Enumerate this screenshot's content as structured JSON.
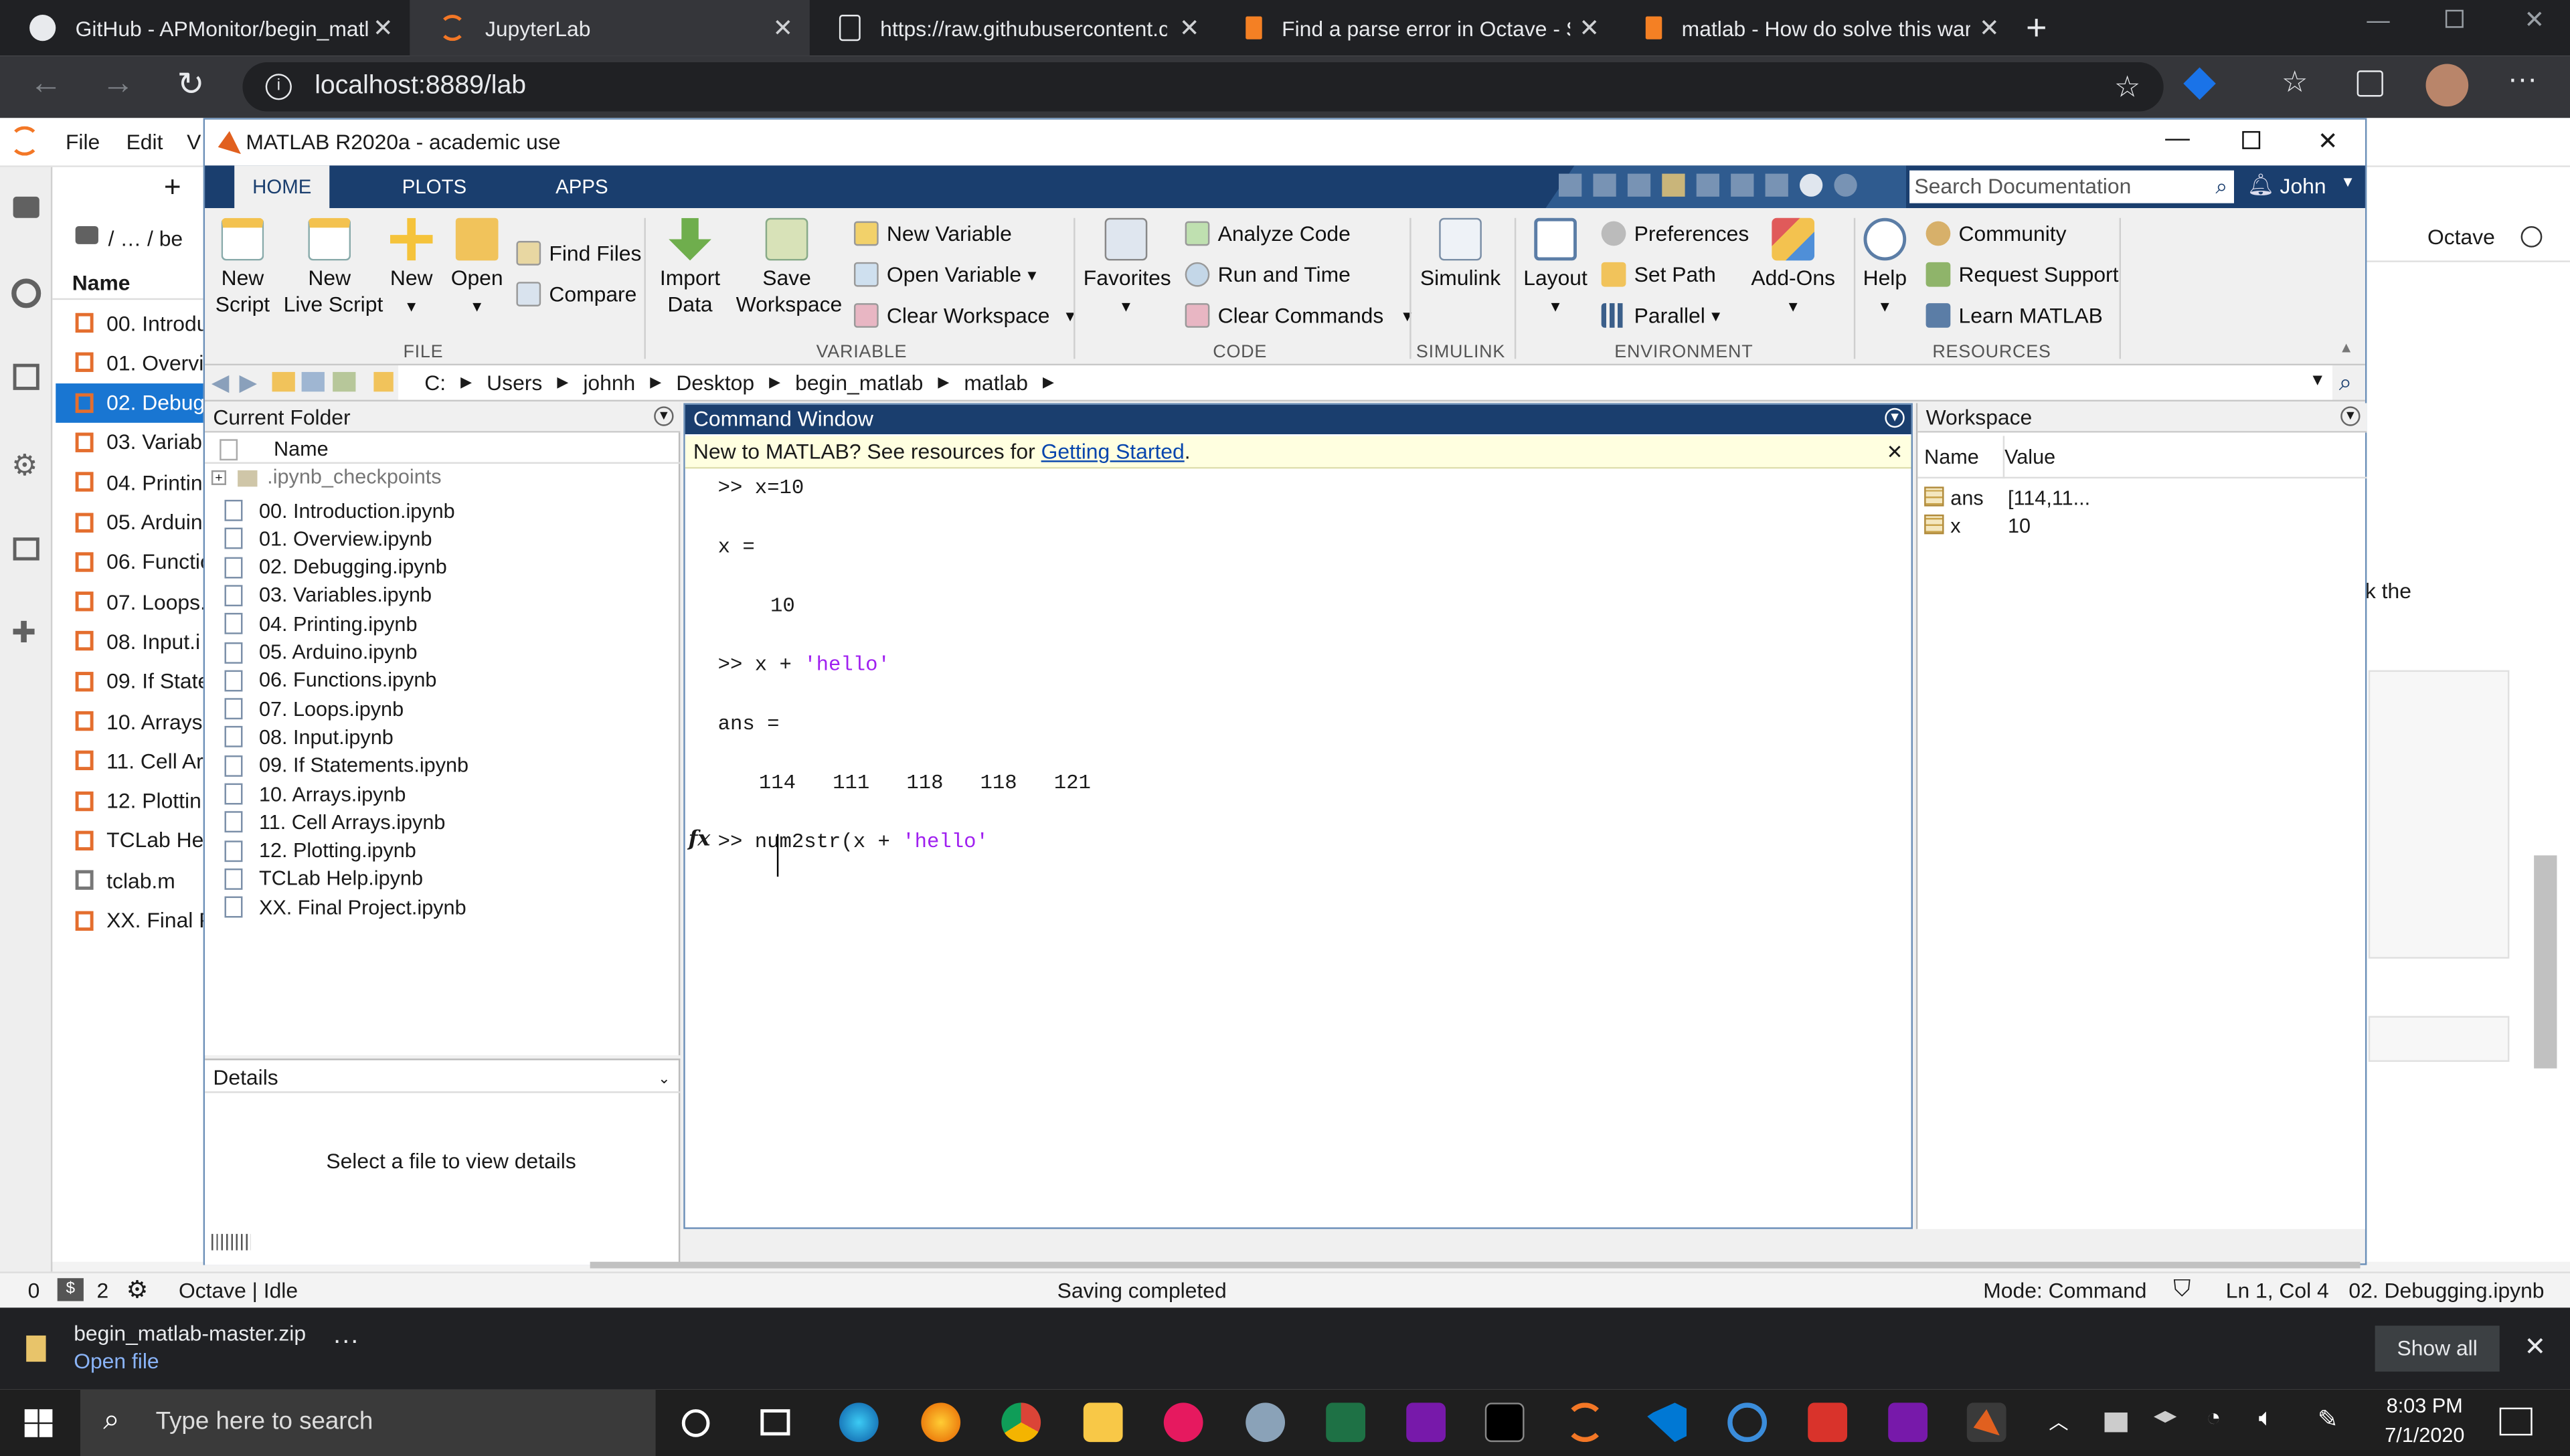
{
  "browser": {
    "tabs": [
      {
        "label": "GitHub - APMonitor/begin_matl"
      },
      {
        "label": "JupyterLab"
      },
      {
        "label": "https://raw.githubusercontent.co"
      },
      {
        "label": "Find a parse error in Octave - Sta"
      },
      {
        "label": "matlab - How do solve this warn"
      }
    ],
    "url": "localhost:8889/lab"
  },
  "jupyter": {
    "menu": [
      "File",
      "Edit",
      "V"
    ],
    "breadcrumb": "/ … / be",
    "name_header": "Name",
    "files": [
      "00. Introdu",
      "01. Overvi",
      "02. Debug",
      "03. Variab",
      "04. Printin",
      "05. Arduin",
      "06. Functio",
      "07. Loops.",
      "08. Input.i",
      "09. If State",
      "10. Arrays",
      "11. Cell Ar",
      "12. Plottin",
      "TCLab Hel",
      "tclab.m",
      "XX. Final P"
    ],
    "kernel_label": "Octave",
    "side_text": "k the",
    "status": {
      "left_num1": "0",
      "left_num2": "2",
      "kernel_state": "Octave | Idle",
      "center": "Saving completed",
      "mode": "Mode: Command",
      "position": "Ln 1, Col 4",
      "file": "02. Debugging.ipynb"
    }
  },
  "matlab": {
    "title": "MATLAB R2020a - academic use",
    "tabs": [
      "HOME",
      "PLOTS",
      "APPS"
    ],
    "search_placeholder": "Search Documentation",
    "user": "John",
    "ribbon": {
      "new_script": "New\nScript",
      "new_live_script": "New\nLive Script",
      "new": "New",
      "open": "Open",
      "find_files": "Find Files",
      "compare": "Compare",
      "import_data": "Import\nData",
      "save_workspace": "Save\nWorkspace",
      "new_variable": "New Variable",
      "open_variable": "Open Variable",
      "clear_workspace": "Clear Workspace",
      "favorites": "Favorites",
      "analyze_code": "Analyze Code",
      "run_and_time": "Run and Time",
      "clear_commands": "Clear Commands",
      "simulink": "Simulink",
      "layout": "Layout",
      "preferences": "Preferences",
      "set_path": "Set Path",
      "parallel": "Parallel",
      "add_ons": "Add-Ons",
      "help": "Help",
      "community": "Community",
      "request_support": "Request Support",
      "learn_matlab": "Learn MATLAB",
      "groups": [
        "FILE",
        "VARIABLE",
        "CODE",
        "SIMULINK",
        "ENVIRONMENT",
        "RESOURCES"
      ]
    },
    "path": [
      "C:",
      "Users",
      "johnh",
      "Desktop",
      "begin_matlab",
      "matlab"
    ],
    "current_folder": {
      "title": "Current Folder",
      "name_header": "Name",
      "checkpoints": ".ipynb_checkpoints",
      "files": [
        "00. Introduction.ipynb",
        "01. Overview.ipynb",
        "02. Debugging.ipynb",
        "03. Variables.ipynb",
        "04. Printing.ipynb",
        "05. Arduino.ipynb",
        "06. Functions.ipynb",
        "07. Loops.ipynb",
        "08. Input.ipynb",
        "09. If Statements.ipynb",
        "10. Arrays.ipynb",
        "11. Cell Arrays.ipynb",
        "12. Plotting.ipynb",
        "TCLab Help.ipynb",
        "XX. Final Project.ipynb"
      ]
    },
    "details": {
      "title": "Details",
      "message": "Select a file to view details"
    },
    "command_window": {
      "title": "Command Window",
      "banner_text": "New to MATLAB? See resources for ",
      "banner_link": "Getting Started",
      "banner_end": ".",
      "lines": {
        "l1_prompt": ">> ",
        "l1_code": "x=10",
        "l2": "x =",
        "l3": "10",
        "l4_prompt": ">> ",
        "l4_code": "x + ",
        "l4_str": "'hello'",
        "l5": "ans =",
        "l6": "114   111   118   118   121",
        "l7_fx": "fx",
        "l7_prompt": ">> ",
        "l7_code": "num2str(x + ",
        "l7_str": "'hello'"
      }
    },
    "workspace": {
      "title": "Workspace",
      "headers": [
        "Name",
        "Value"
      ],
      "rows": [
        {
          "name": "ans",
          "value": "[114,11..."
        },
        {
          "name": "x",
          "value": "10"
        }
      ]
    }
  },
  "download": {
    "filename": "begin_matlab-master.zip",
    "action": "Open file",
    "show_all": "Show all"
  },
  "taskbar": {
    "search_placeholder": "Type here to search",
    "time": "8:03 PM",
    "date": "7/1/2020"
  }
}
